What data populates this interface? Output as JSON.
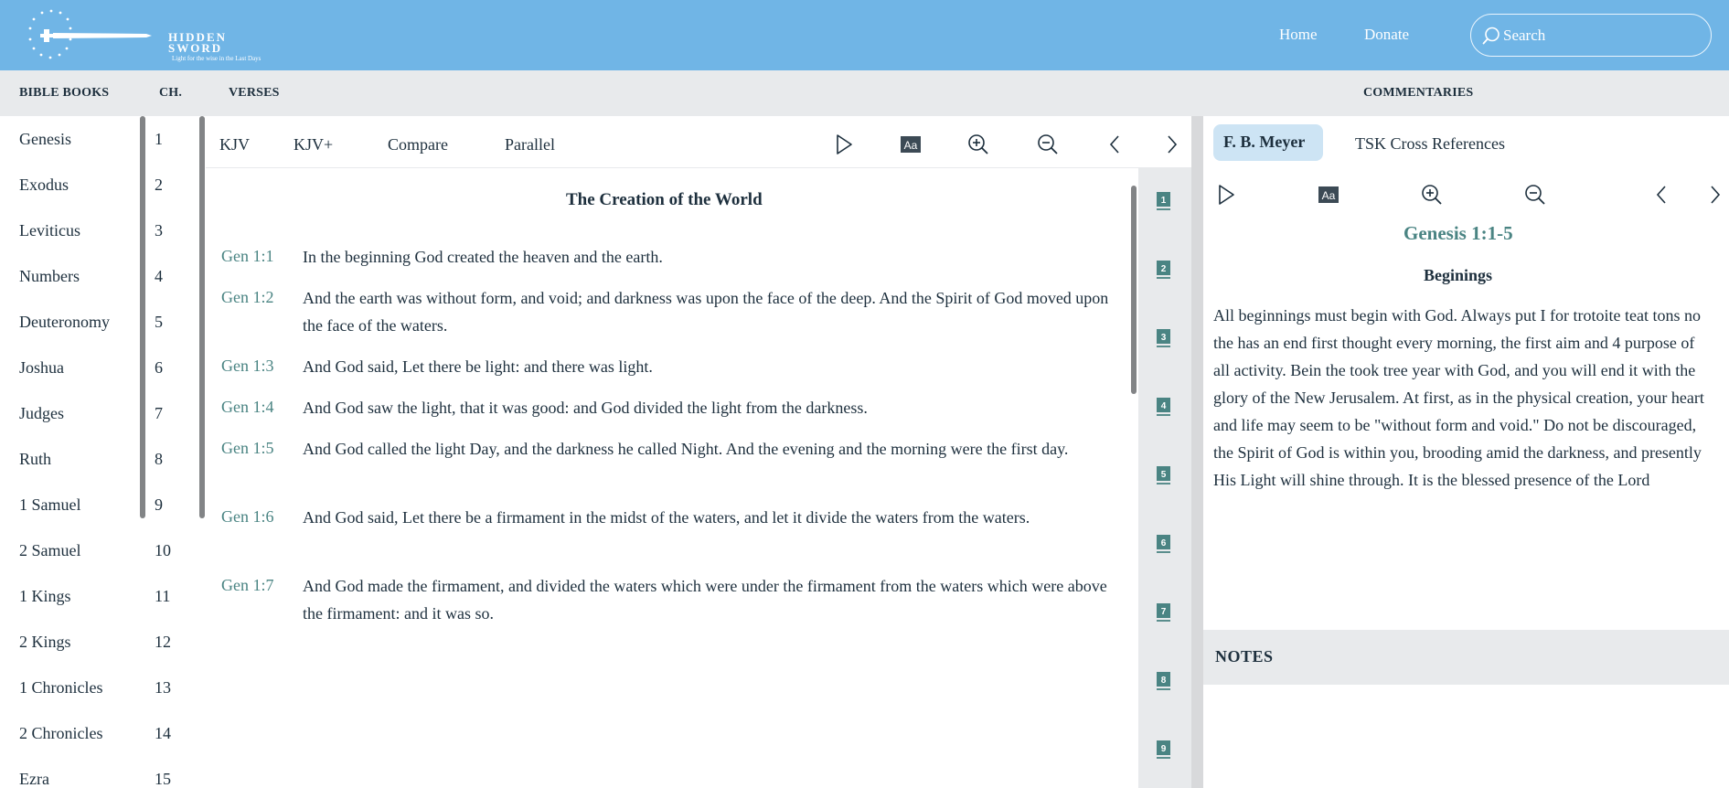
{
  "header": {
    "logo_title": "HIDDEN SWORD",
    "logo_tagline": "Light for the wise in the Last Days",
    "nav": [
      "Home",
      "Donate"
    ],
    "search_placeholder": "Search"
  },
  "columns": {
    "books": "BIBLE BOOKS",
    "chapters": "CH.",
    "verses": "VERSES",
    "commentaries": "COMMENTARIES"
  },
  "books": [
    "Genesis",
    "Exodus",
    "Leviticus",
    "Numbers",
    "Deuteronomy",
    "Joshua",
    "Judges",
    "Ruth",
    "1 Samuel",
    "2 Samuel",
    "1 Kings",
    "2 Kings",
    "1 Chronicles",
    "2 Chronicles",
    "Ezra"
  ],
  "chapters": [
    "1",
    "2",
    "3",
    "4",
    "5",
    "6",
    "7",
    "8",
    "9",
    "10",
    "11",
    "12",
    "13",
    "14",
    "15"
  ],
  "verse_tabs": [
    "KJV",
    "KJV+",
    "Compare",
    "Parallel"
  ],
  "verse_heading": "The Creation of the World",
  "verses": [
    {
      "ref": "Gen 1:1",
      "text": "In the beginning God created the heaven and the earth."
    },
    {
      "ref": "Gen 1:2",
      "text": "And the earth was without form, and void; and darkness was upon the face of the deep. And the Spirit of God moved upon the face of the waters."
    },
    {
      "ref": "Gen 1:3",
      "text": "And God said, Let there be light: and there was light."
    },
    {
      "ref": "Gen 1:4",
      "text": "And God saw the light, that it was good: and God divided the light from the darkness."
    },
    {
      "ref": "Gen 1:5",
      "text": "And God called the light Day, and the darkness he called Night. And the evening and the morning were the first day."
    },
    {
      "ref": "Gen 1:6",
      "text": "And God said, Let there be a firmament in the midst of the waters, and let it divide the waters from the waters."
    },
    {
      "ref": "Gen 1:7",
      "text": "And God made the firmament, and divided the waters which were under the firmament from the waters which were above the firmament: and it was so."
    }
  ],
  "verse_markers": [
    "1",
    "2",
    "3",
    "4",
    "5",
    "6",
    "7",
    "8",
    "9"
  ],
  "commentary": {
    "tabs": [
      "F. B. Meyer",
      "TSK Cross References"
    ],
    "reference": "Genesis 1:1-5",
    "title": "Beginings",
    "body": "All beginnings must begin with God. Always put I for trotoite teat tons no the has an end first thought every morning, the first aim and 4 purpose of all activity. Bein the took tree year with God, and you will end it with the glory of the New Jerusalem. At first, as in the physical creation, your heart and life may seem to be \"without form and void.\" Do not be discouraged, the Spirit of God is within you, brooding amid the darkness, and presently His Light will shine through. It is the blessed presence of the Lord"
  },
  "notes_label": "NOTES",
  "colors": {
    "header_bg": "#70b5e6",
    "subheader_bg": "#e8eaec",
    "accent_teal": "#4a8483",
    "active_pill": "#cde4f4",
    "text_dark": "#1d2f3d"
  }
}
